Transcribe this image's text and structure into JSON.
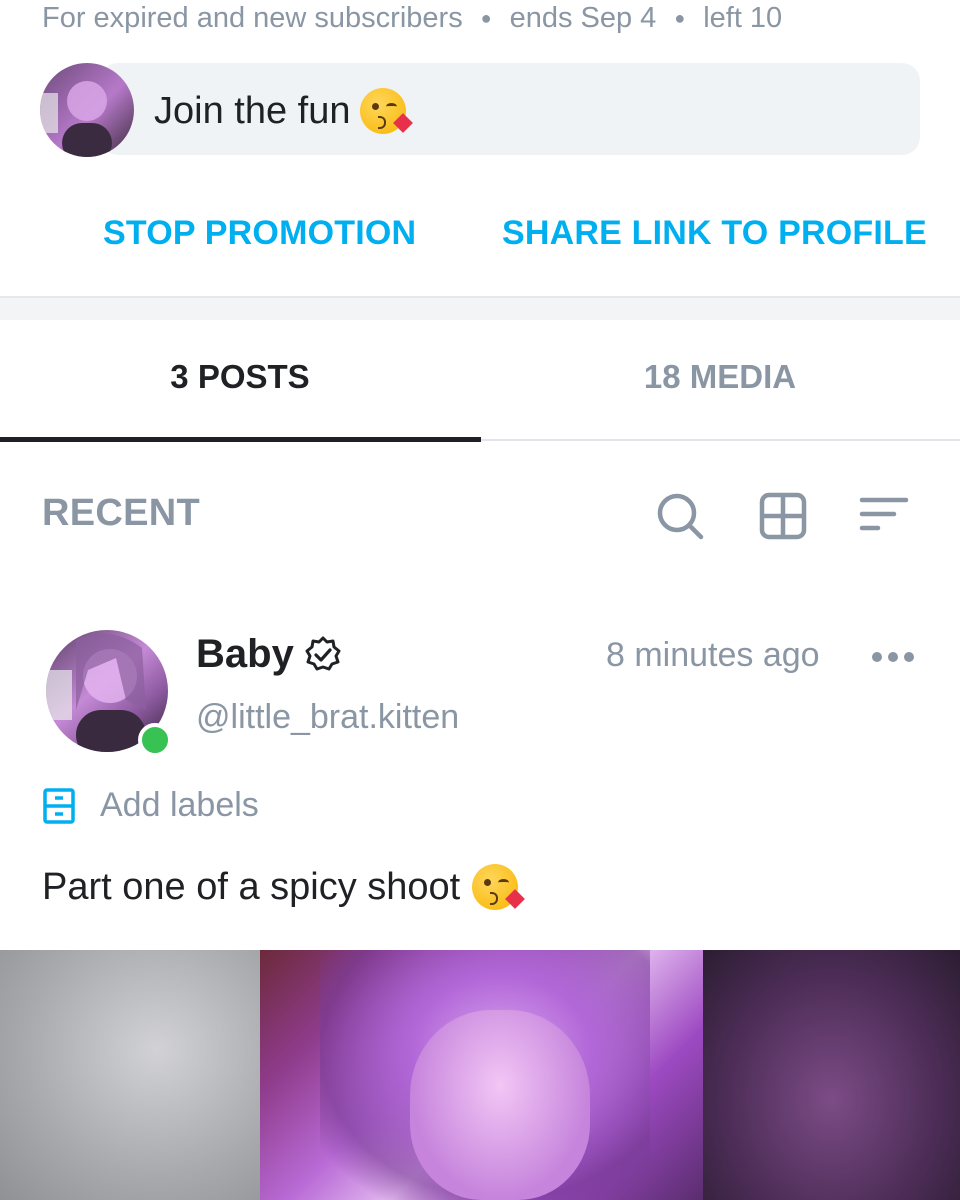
{
  "promo": {
    "meta": {
      "audience": "For expired and new subscribers",
      "ends": "ends Sep 4",
      "left": "left 10"
    },
    "message": "Join the fun",
    "emoji": "kissing-face-emoji",
    "stop_label": "STOP PROMOTION",
    "share_label": "SHARE LINK TO PROFILE"
  },
  "tabs": [
    {
      "label": "3 POSTS",
      "active": true
    },
    {
      "label": "18 MEDIA",
      "active": false
    }
  ],
  "toolbar": {
    "recent_label": "RECENT",
    "icons": [
      "search-icon",
      "grid-icon",
      "sort-icon"
    ]
  },
  "post": {
    "name": "Baby",
    "verified_icon": "verified-badge-icon",
    "handle": "@little_brat.kitten",
    "time": "8 minutes ago",
    "online": true,
    "labels_text": "Add labels",
    "text": "Part one of a spicy shoot",
    "emoji": "kissing-face-emoji"
  },
  "colors": {
    "accent": "#00aff0",
    "muted": "#8a96a3",
    "text": "#1f2125",
    "online": "#38c253",
    "bubble": "#f0f3f6"
  }
}
